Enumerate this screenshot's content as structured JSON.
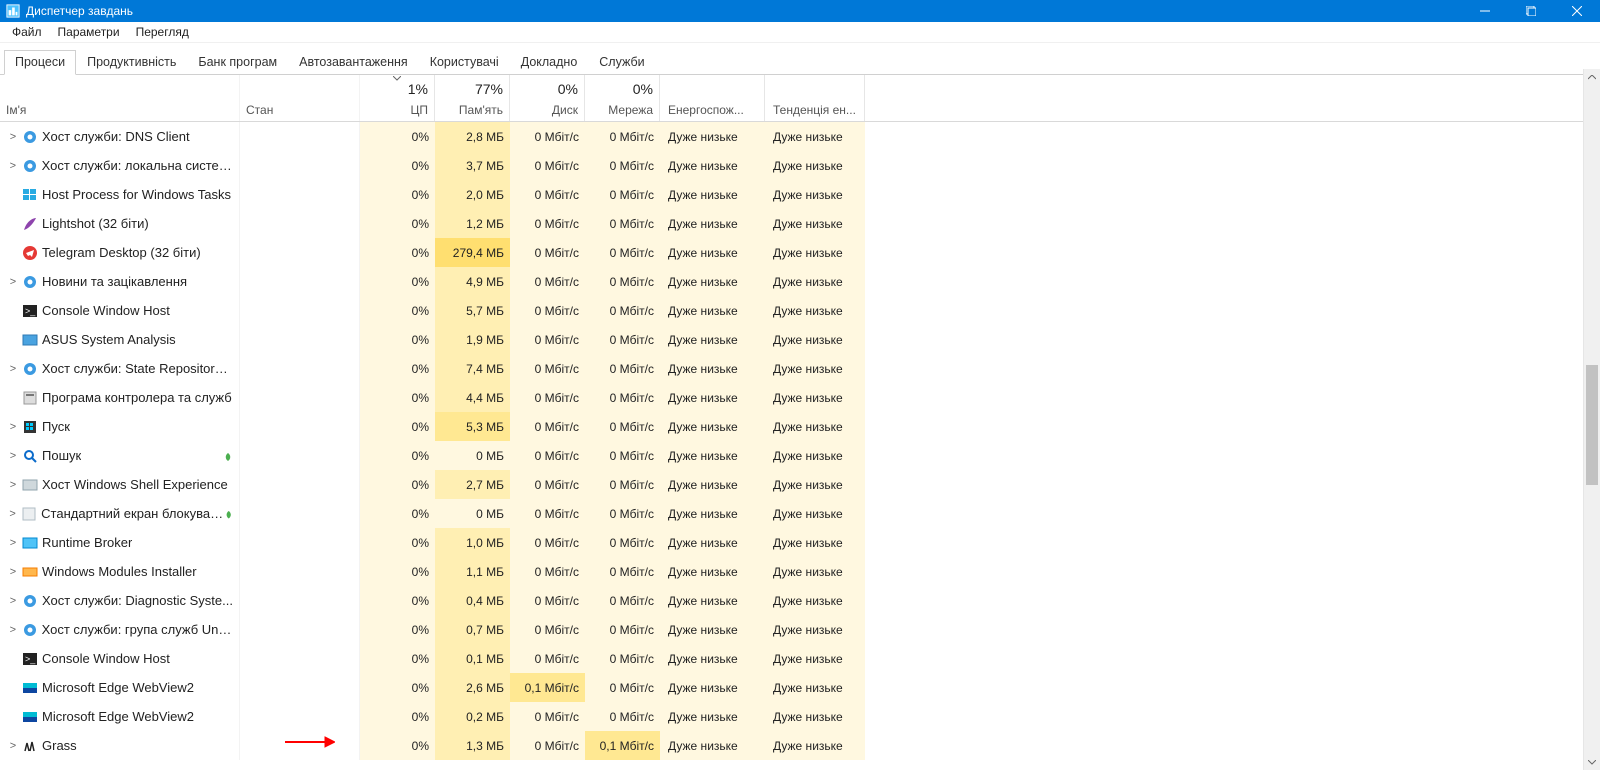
{
  "window_title": "Диспетчер завдань",
  "menu": [
    "Файл",
    "Параметри",
    "Перегляд"
  ],
  "tabs": [
    "Процеси",
    "Продуктивність",
    "Банк програм",
    "Автозавантаження",
    "Користувачі",
    "Докладно",
    "Служби"
  ],
  "active_tab": 0,
  "columns": {
    "name": "Ім'я",
    "status": "Стан",
    "cpu": "ЦП",
    "mem": "Пам'ять",
    "disk": "Диск",
    "net": "Мережа",
    "energy": "Енергоспож...",
    "trend": "Тенденція ен..."
  },
  "totals": {
    "cpu": "1%",
    "mem": "77%",
    "disk": "0%",
    "net": "0%"
  },
  "energy_label": "Дуже низьке",
  "rows": [
    {
      "exp": true,
      "icon": "gear",
      "name": "Хост служби: DNS Client",
      "cpu": "0%",
      "mem": "2,8 МБ",
      "disk": "0 Мбіт/с",
      "net": "0 Мбіт/с",
      "mem_t": 1,
      "disk_t": 0,
      "net_t": 0
    },
    {
      "exp": true,
      "icon": "gear",
      "name": "Хост служби: локальна систем...",
      "cpu": "0%",
      "mem": "3,7 МБ",
      "disk": "0 Мбіт/с",
      "net": "0 Мбіт/с",
      "mem_t": 1,
      "disk_t": 0,
      "net_t": 0
    },
    {
      "exp": false,
      "icon": "win",
      "name": "Host Process for Windows Tasks",
      "cpu": "0%",
      "mem": "2,0 МБ",
      "disk": "0 Мбіт/с",
      "net": "0 Мбіт/с",
      "mem_t": 1,
      "disk_t": 0,
      "net_t": 0
    },
    {
      "exp": false,
      "icon": "feather",
      "name": "Lightshot (32 біти)",
      "cpu": "0%",
      "mem": "1,2 МБ",
      "disk": "0 Мбіт/с",
      "net": "0 Мбіт/с",
      "mem_t": 1,
      "disk_t": 0,
      "net_t": 0
    },
    {
      "exp": false,
      "icon": "tg",
      "name": "Telegram Desktop (32 біти)",
      "cpu": "0%",
      "mem": "279,4 МБ",
      "disk": "0 Мбіт/с",
      "net": "0 Мбіт/с",
      "mem_t": 3,
      "disk_t": 0,
      "net_t": 0
    },
    {
      "exp": true,
      "icon": "gear",
      "name": "Новини та зацікавлення",
      "cpu": "0%",
      "mem": "4,9 МБ",
      "disk": "0 Мбіт/с",
      "net": "0 Мбіт/с",
      "mem_t": 1,
      "disk_t": 0,
      "net_t": 0
    },
    {
      "exp": false,
      "icon": "console",
      "name": "Console Window Host",
      "cpu": "0%",
      "mem": "5,7 МБ",
      "disk": "0 Мбіт/с",
      "net": "0 Мбіт/с",
      "mem_t": 1,
      "disk_t": 0,
      "net_t": 0
    },
    {
      "exp": false,
      "icon": "asus",
      "name": "ASUS System Analysis",
      "cpu": "0%",
      "mem": "1,9 МБ",
      "disk": "0 Мбіт/с",
      "net": "0 Мбіт/с",
      "mem_t": 1,
      "disk_t": 0,
      "net_t": 0
    },
    {
      "exp": true,
      "icon": "gear",
      "name": "Хост служби: State Repository ...",
      "cpu": "0%",
      "mem": "7,4 МБ",
      "disk": "0 Мбіт/с",
      "net": "0 Мбіт/с",
      "mem_t": 1,
      "disk_t": 0,
      "net_t": 0
    },
    {
      "exp": false,
      "icon": "app",
      "name": "Програма контролера та служб",
      "cpu": "0%",
      "mem": "4,4 МБ",
      "disk": "0 Мбіт/с",
      "net": "0 Мбіт/с",
      "mem_t": 1,
      "disk_t": 0,
      "net_t": 0
    },
    {
      "exp": true,
      "icon": "start",
      "name": "Пуск",
      "cpu": "0%",
      "mem": "5,3 МБ",
      "disk": "0 Мбіт/с",
      "net": "0 Мбіт/с",
      "mem_t": 2,
      "disk_t": 0,
      "net_t": 0
    },
    {
      "exp": true,
      "icon": "search",
      "name": "Пошук",
      "leaf": true,
      "cpu": "0%",
      "mem": "0 МБ",
      "disk": "0 Мбіт/с",
      "net": "0 Мбіт/с",
      "mem_t": 0,
      "disk_t": 0,
      "net_t": 0
    },
    {
      "exp": true,
      "icon": "shell",
      "name": "Хост Windows Shell Experience",
      "cpu": "0%",
      "mem": "2,7 МБ",
      "disk": "0 Мбіт/с",
      "net": "0 Мбіт/с",
      "mem_t": 1,
      "disk_t": 0,
      "net_t": 0
    },
    {
      "exp": true,
      "icon": "lock",
      "name": "Стандартний екран блокуванн...",
      "leaf": true,
      "cpu": "0%",
      "mem": "0 МБ",
      "disk": "0 Мбіт/с",
      "net": "0 Мбіт/с",
      "mem_t": 0,
      "disk_t": 0,
      "net_t": 0
    },
    {
      "exp": true,
      "icon": "rt",
      "name": "Runtime Broker",
      "cpu": "0%",
      "mem": "1,0 МБ",
      "disk": "0 Мбіт/с",
      "net": "0 Мбіт/с",
      "mem_t": 1,
      "disk_t": 0,
      "net_t": 0
    },
    {
      "exp": true,
      "icon": "mod",
      "name": "Windows Modules Installer",
      "cpu": "0%",
      "mem": "1,1 МБ",
      "disk": "0 Мбіт/с",
      "net": "0 Мбіт/с",
      "mem_t": 1,
      "disk_t": 0,
      "net_t": 0
    },
    {
      "exp": true,
      "icon": "gear",
      "name": "Хост служби: Diagnostic Syste...",
      "cpu": "0%",
      "mem": "0,4 МБ",
      "disk": "0 Мбіт/с",
      "net": "0 Мбіт/с",
      "mem_t": 1,
      "disk_t": 0,
      "net_t": 0
    },
    {
      "exp": true,
      "icon": "gear",
      "name": "Хост служби: група служб Unis...",
      "cpu": "0%",
      "mem": "0,7 МБ",
      "disk": "0 Мбіт/с",
      "net": "0 Мбіт/с",
      "mem_t": 1,
      "disk_t": 0,
      "net_t": 0
    },
    {
      "exp": false,
      "icon": "console",
      "name": "Console Window Host",
      "cpu": "0%",
      "mem": "0,1 МБ",
      "disk": "0 Мбіт/с",
      "net": "0 Мбіт/с",
      "mem_t": 1,
      "disk_t": 0,
      "net_t": 0
    },
    {
      "exp": false,
      "icon": "edge",
      "name": "Microsoft Edge WebView2",
      "cpu": "0%",
      "mem": "2,6 МБ",
      "disk": "0,1 Мбіт/с",
      "net": "0 Мбіт/с",
      "mem_t": 1,
      "disk_t": 2,
      "net_t": 0
    },
    {
      "exp": false,
      "icon": "edge",
      "name": "Microsoft Edge WebView2",
      "cpu": "0%",
      "mem": "0,2 МБ",
      "disk": "0 Мбіт/с",
      "net": "0 Мбіт/с",
      "mem_t": 1,
      "disk_t": 0,
      "net_t": 0
    },
    {
      "exp": true,
      "icon": "grass",
      "name": "Grass",
      "cpu": "0%",
      "mem": "1,3 МБ",
      "disk": "0 Мбіт/с",
      "net": "0,1 Мбіт/с",
      "mem_t": 1,
      "disk_t": 0,
      "net_t": 2
    }
  ]
}
